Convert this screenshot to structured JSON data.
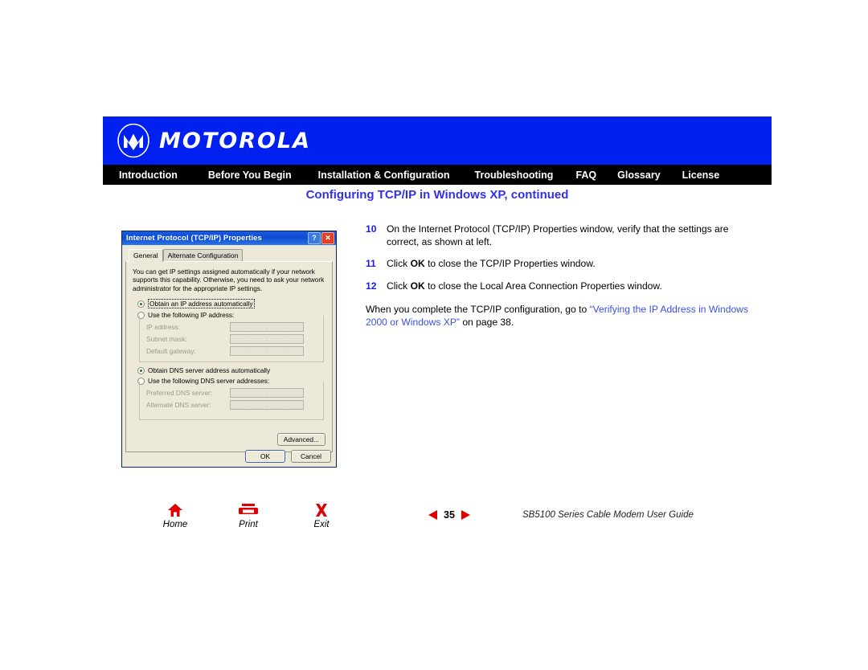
{
  "header": {
    "brand": "MOTOROLA",
    "logo_icon": "motorola-m-logo",
    "band_color": "#0020f0"
  },
  "nav": {
    "background": "#000000",
    "items": [
      {
        "label": "Introduction"
      },
      {
        "label": "Before You Begin"
      },
      {
        "label": "Installation & Configuration"
      },
      {
        "label": "Troubleshooting"
      },
      {
        "label": "FAQ"
      },
      {
        "label": "Glossary"
      },
      {
        "label": "License"
      }
    ]
  },
  "page": {
    "title": "Configuring TCP/IP in Windows XP, continued",
    "title_color": "#3030ee"
  },
  "instructions": {
    "steps": [
      {
        "number": "10",
        "text_before": "On the Internet Protocol (TCP/IP) Properties window, verify that the settings are correct, as shown at left.",
        "bold": "",
        "text_after": ""
      },
      {
        "number": "11",
        "text_before": "Click ",
        "bold": "OK",
        "text_after": " to close the TCP/IP Properties window."
      },
      {
        "number": "12",
        "text_before": "Click ",
        "bold": "OK",
        "text_after": " to close the Local Area Connection Properties window."
      }
    ],
    "closing": {
      "lead": "When you complete the TCP/IP configuration, go to ",
      "link": "“Verifying the IP Address in Windows 2000 or Windows XP”",
      "tail": " on page 38.",
      "link_color": "#3a50e8"
    }
  },
  "dialog": {
    "title": "Internet Protocol (TCP/IP) Properties",
    "titlebar_buttons": [
      {
        "name": "help-button",
        "glyph": "?"
      },
      {
        "name": "close-button",
        "glyph": "✕"
      }
    ],
    "tabs": [
      {
        "label": "General",
        "active": true
      },
      {
        "label": "Alternate Configuration",
        "active": false
      }
    ],
    "intro_text": "You can get IP settings assigned automatically if your network supports this capability. Otherwise, you need to ask your network administrator for the appropriate IP settings.",
    "ip_options": [
      {
        "label": "Obtain an IP address automatically",
        "checked": true,
        "focused": true
      },
      {
        "label": "Use the following IP address:",
        "checked": false,
        "focused": false
      }
    ],
    "ip_fields": [
      {
        "label": "IP address:",
        "value": ""
      },
      {
        "label": "Subnet mask:",
        "value": ""
      },
      {
        "label": "Default gateway:",
        "value": ""
      }
    ],
    "dns_options": [
      {
        "label": "Obtain DNS server address automatically",
        "checked": true,
        "focused": false
      },
      {
        "label": "Use the following DNS server addresses:",
        "checked": false,
        "focused": false
      }
    ],
    "dns_fields": [
      {
        "label": "Preferred DNS server:",
        "value": ""
      },
      {
        "label": "Alternate DNS server:",
        "value": ""
      }
    ],
    "advanced_button": "Advanced...",
    "ok_button": "OK",
    "cancel_button": "Cancel"
  },
  "footer": {
    "buttons": [
      {
        "label": "Home",
        "icon": "home-icon"
      },
      {
        "label": "Print",
        "icon": "printer-icon"
      },
      {
        "label": "Exit",
        "icon": "exit-x-icon"
      }
    ],
    "pager": {
      "prev_icon": "triangle-left-icon",
      "page": "35",
      "next_icon": "triangle-right-icon",
      "accent": "#e00000"
    },
    "guide_title": "SB5100 Series Cable Modem User Guide"
  }
}
